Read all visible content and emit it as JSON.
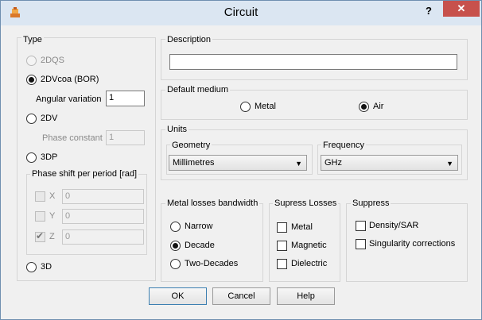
{
  "window": {
    "title": "Circuit",
    "help_glyph": "?",
    "close_glyph": "✕"
  },
  "type_group": {
    "title": "Type",
    "options": {
      "2dqs": "2DQS",
      "2dvcoa": "2DVcoa (BOR)",
      "2dv": "2DV",
      "3dp": "3DP",
      "3d": "3D"
    },
    "selected": "2dvcoa",
    "angular_variation_label": "Angular variation",
    "angular_variation_value": "1",
    "phase_constant_label": "Phase constant",
    "phase_constant_value": "1",
    "phase_shift": {
      "title": "Phase shift per period [rad]",
      "x_label": "X",
      "x_value": "0",
      "y_label": "Y",
      "y_value": "0",
      "z_label": "Z",
      "z_value": "0"
    }
  },
  "description": {
    "title": "Description",
    "value": ""
  },
  "default_medium": {
    "title": "Default medium",
    "metal": "Metal",
    "air": "Air",
    "selected": "air"
  },
  "units": {
    "title": "Units",
    "geometry_title": "Geometry",
    "geometry_value": "Millimetres",
    "frequency_title": "Frequency",
    "frequency_value": "GHz"
  },
  "metal_losses": {
    "title": "Metal losses bandwidth",
    "narrow": "Narrow",
    "decade": "Decade",
    "two_decades": "Two-Decades",
    "selected": "decade"
  },
  "supress_losses": {
    "title": "Supress Losses",
    "metal": "Metal",
    "magnetic": "Magnetic",
    "dielectric": "Dielectric"
  },
  "suppress": {
    "title": "Suppress",
    "density_sar": "Density/SAR",
    "singularity": "Singularity corrections"
  },
  "buttons": {
    "ok": "OK",
    "cancel": "Cancel",
    "help": "Help"
  },
  "icons": {
    "app": "app-icon",
    "dropdown": "▼"
  },
  "colors": {
    "titlebar": "#dbe6f2",
    "close": "#c7514c",
    "dialog_bg": "#f0f0f0"
  }
}
